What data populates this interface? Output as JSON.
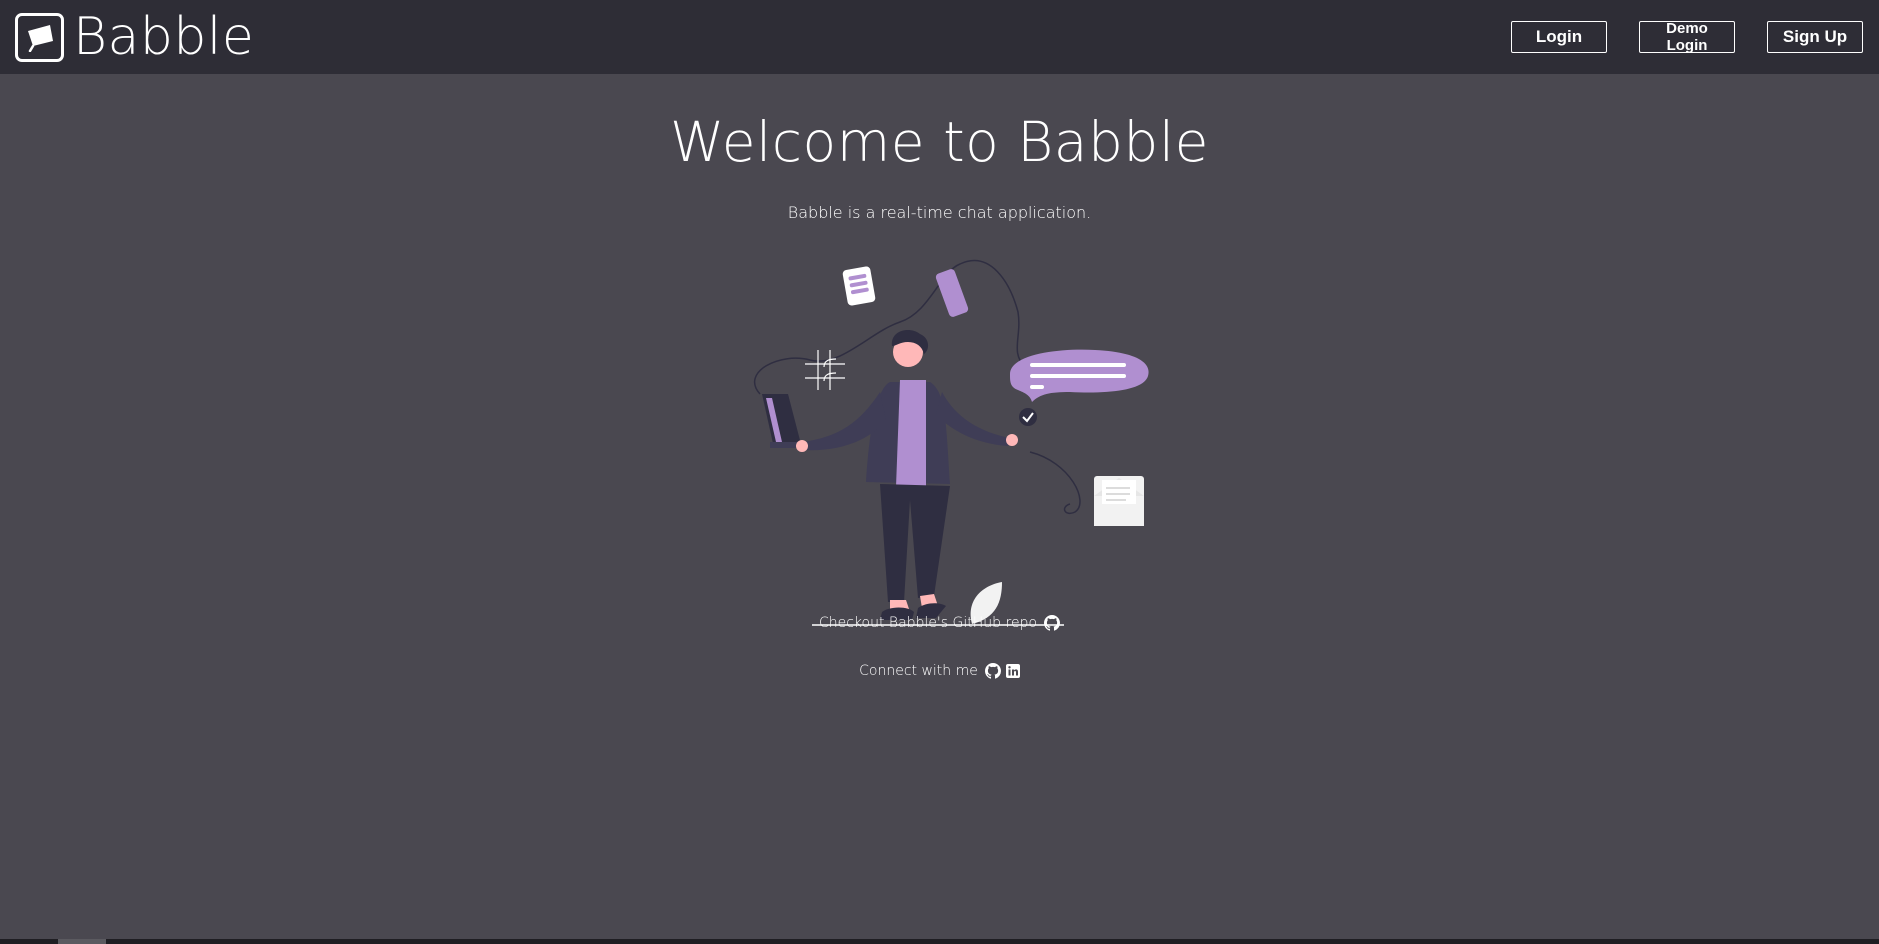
{
  "header": {
    "brand_name": "Babble",
    "login_label": "Login",
    "demo_login_label": "Demo Login",
    "signup_label": "Sign Up"
  },
  "main": {
    "title": "Welcome to Babble",
    "subtitle": "Babble is a real-time chat application.",
    "repo_link_text": "Checkout Babble's GitHub repo",
    "connect_text": "Connect with me"
  },
  "icons": {
    "brand": "flag-icon",
    "repo": "github-icon",
    "connect": [
      "github-icon",
      "linkedin-icon"
    ]
  },
  "colors": {
    "navbar": "#2e2d36",
    "background": "#4a4850",
    "accent": "#b08fd0",
    "figure_dark": "#2f2e41"
  }
}
